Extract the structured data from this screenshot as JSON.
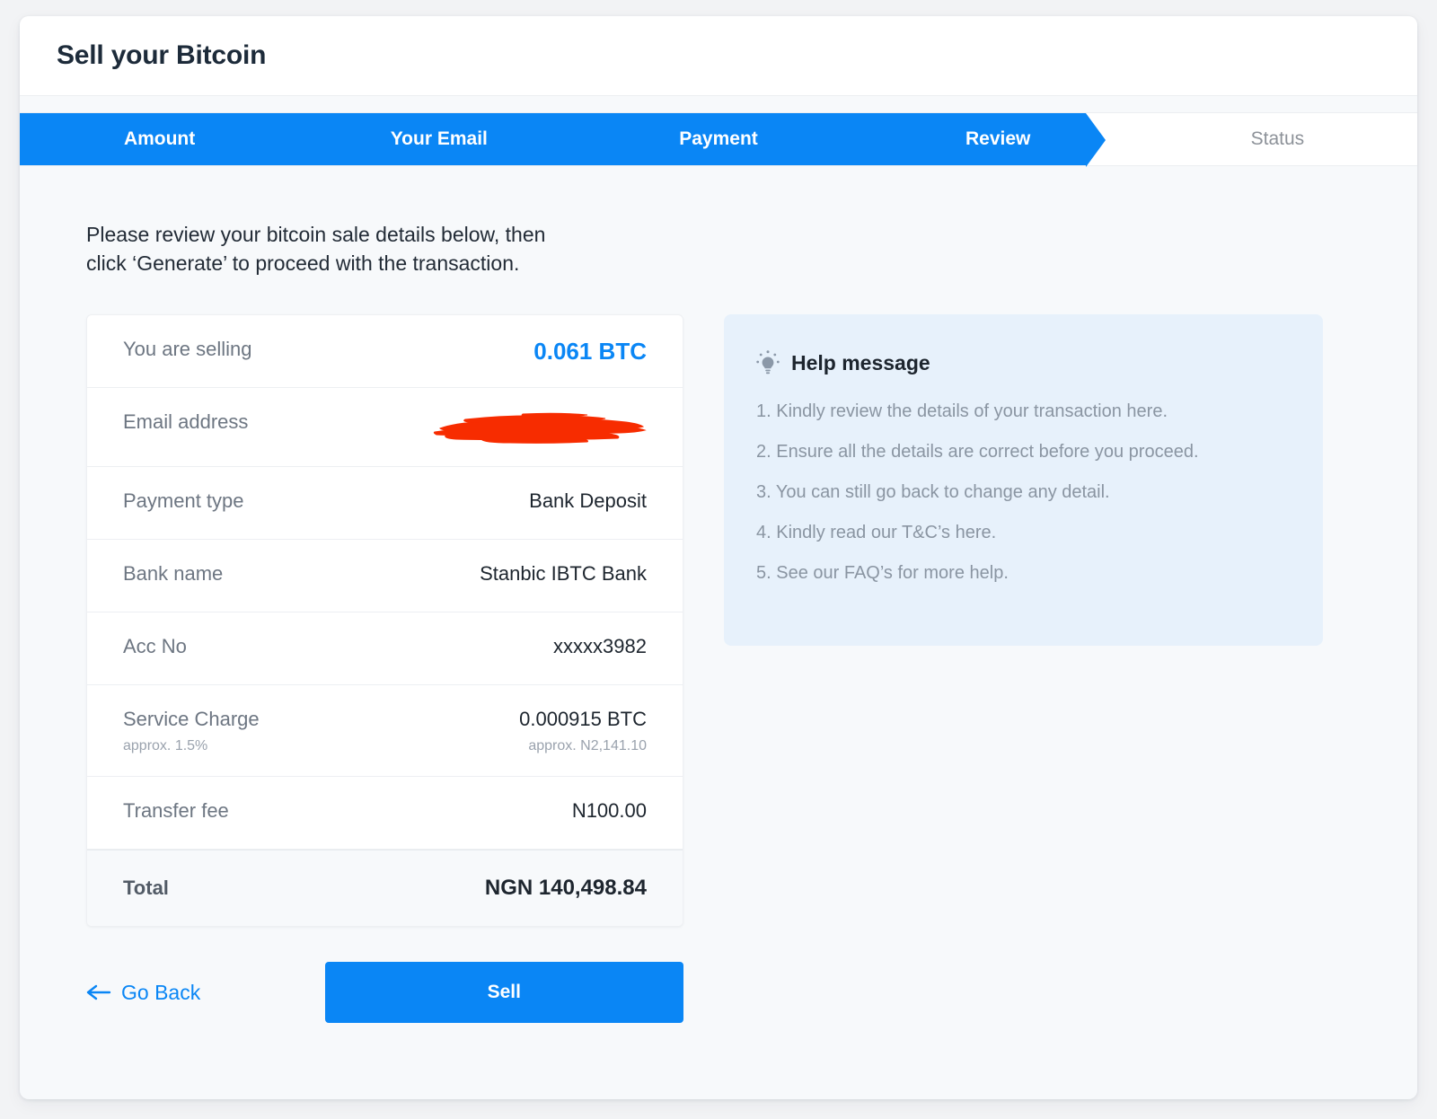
{
  "header": {
    "title": "Sell your Bitcoin"
  },
  "stepper": {
    "steps": [
      {
        "label": "Amount",
        "state": "complete"
      },
      {
        "label": "Your Email",
        "state": "complete"
      },
      {
        "label": "Payment",
        "state": "complete"
      },
      {
        "label": "Review",
        "state": "current"
      },
      {
        "label": "Status",
        "state": "upcoming"
      }
    ]
  },
  "intro": {
    "line1": "Please review your bitcoin sale details below, then",
    "line2": "click ‘Generate’ to proceed with the transaction."
  },
  "details": {
    "rows": [
      {
        "label": "You are selling",
        "value": "0.061 BTC",
        "style": "accent"
      },
      {
        "label": "Email address",
        "value": "",
        "style": "redacted",
        "redaction_color": "#f72c00"
      },
      {
        "label": "Payment type",
        "value": "Bank Deposit",
        "style": "normal"
      },
      {
        "label": "Bank name",
        "value": "Stanbic IBTC Bank",
        "style": "normal"
      },
      {
        "label": "Acc No",
        "value": "xxxxx3982",
        "style": "normal"
      },
      {
        "label": "Service Charge",
        "label_sub": "approx. 1.5%",
        "value": "0.000915 BTC",
        "value_sub": "approx. N2,141.10",
        "style": "normal"
      },
      {
        "label": "Transfer fee",
        "value": "N100.00",
        "style": "normal"
      }
    ],
    "total": {
      "label": "Total",
      "value": "NGN 140,498.84"
    }
  },
  "help": {
    "icon": "lightbulb-icon",
    "title": "Help message",
    "items": [
      "1. Kindly review the details of your transaction here.",
      "2. Ensure all the details are correct before you proceed.",
      "3. You can still go back to change any detail.",
      "4. Kindly read our T&C’s here.",
      "5. See our FAQ’s for more help."
    ]
  },
  "actions": {
    "back_label": "Go Back",
    "back_icon": "arrow-left-icon",
    "submit_label": "Sell"
  },
  "colors": {
    "accent": "#0a86f5",
    "help_background": "#e7f1fb",
    "page_background": "#f2f3f5",
    "title_text": "#1d2b3a"
  }
}
